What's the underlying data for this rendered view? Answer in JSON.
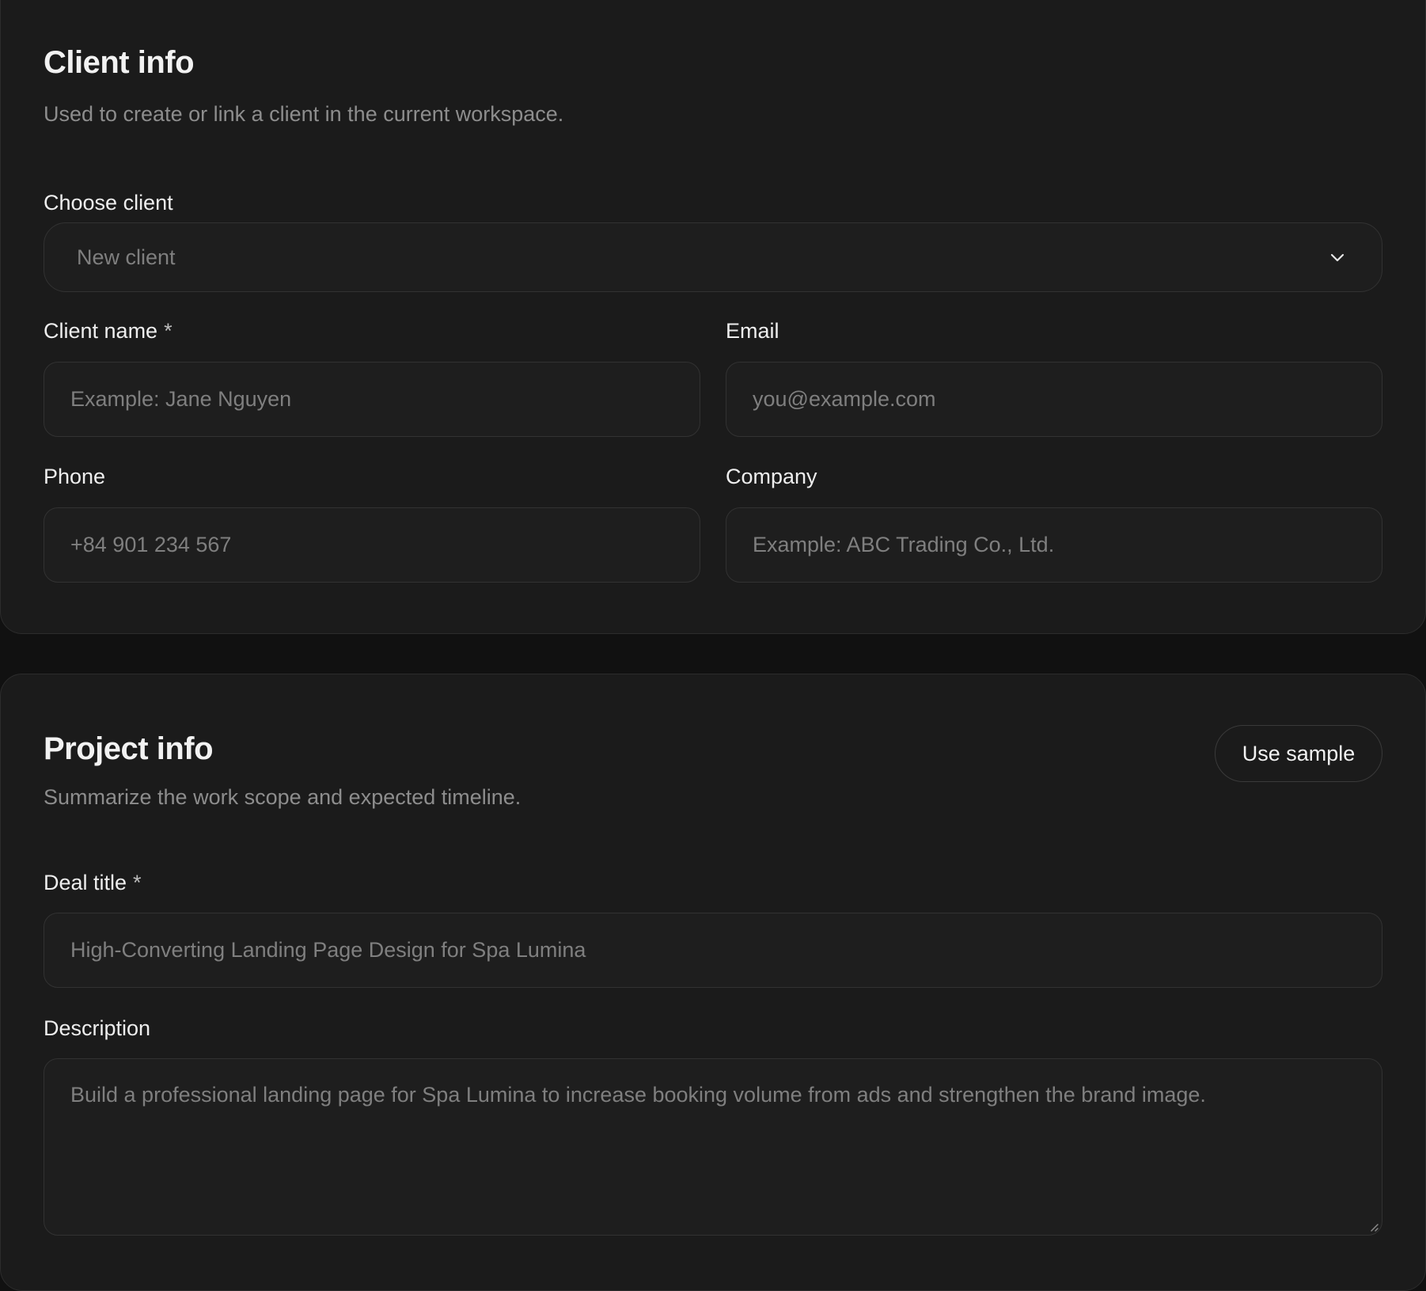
{
  "client_section": {
    "title": "Client info",
    "subtitle": "Used to create or link a client in the current workspace.",
    "choose_client": {
      "label": "Choose client",
      "value": "New client",
      "icon": "chevron-down-icon"
    },
    "client_name": {
      "label": "Client name",
      "required_mark": "*",
      "placeholder": "Example: Jane Nguyen"
    },
    "email": {
      "label": "Email",
      "placeholder": "you@example.com"
    },
    "phone": {
      "label": "Phone",
      "placeholder": "+84 901 234 567"
    },
    "company": {
      "label": "Company",
      "placeholder": "Example: ABC Trading Co., Ltd."
    }
  },
  "project_section": {
    "title": "Project info",
    "subtitle": "Summarize the work scope and expected timeline.",
    "use_sample_label": "Use sample",
    "deal_title": {
      "label": "Deal title",
      "required_mark": "*",
      "placeholder": "High-Converting Landing Page Design for Spa Lumina"
    },
    "description": {
      "label": "Description",
      "placeholder": "Build a professional landing page for Spa Lumina to increase booking volume from ads and strengthen the brand image."
    }
  },
  "colors": {
    "page_background": "#111111",
    "card_background": "#1b1b1b",
    "field_background": "#1e1e1e",
    "border": "#323232",
    "text_primary": "#ededed",
    "text_muted": "#8d8d8d"
  }
}
